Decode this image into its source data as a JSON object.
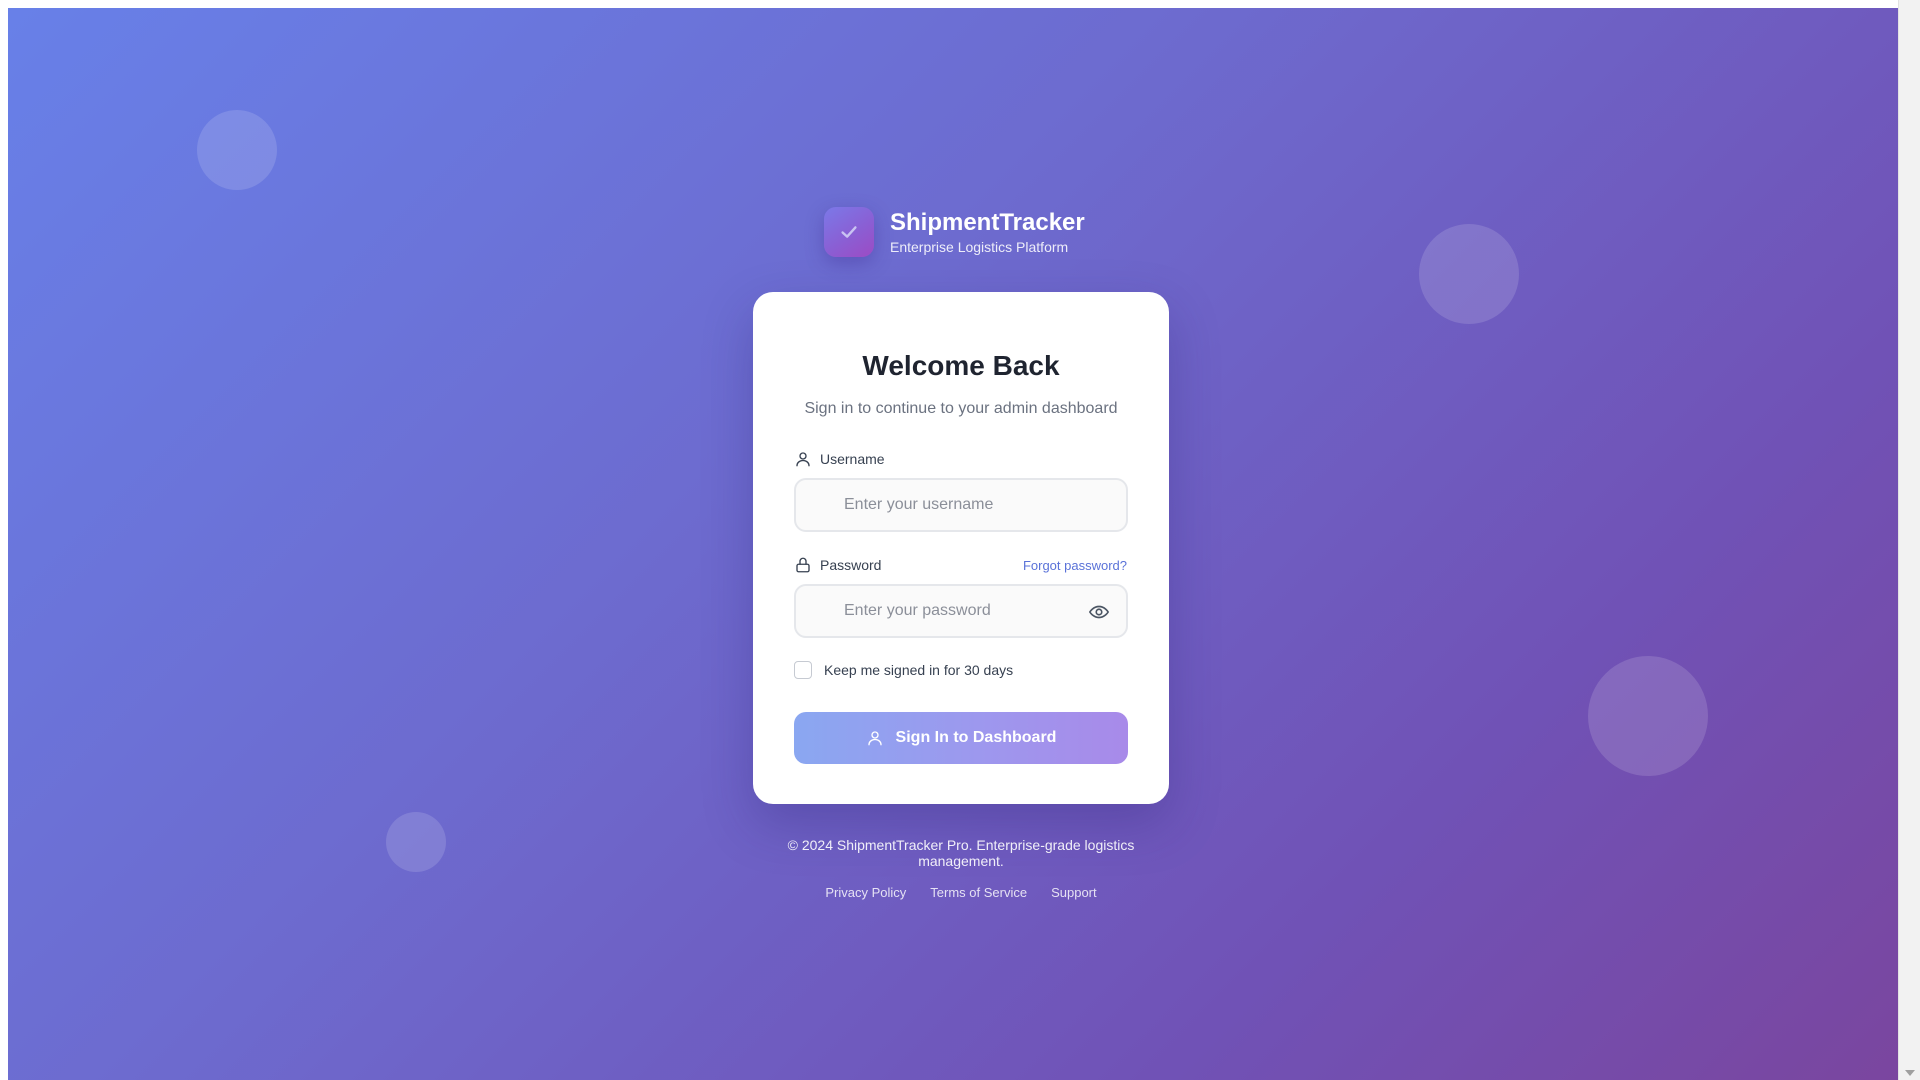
{
  "brand": {
    "name": "ShipmentTracker",
    "tagline": "Enterprise Logistics Platform",
    "logo_icon": "check-icon"
  },
  "card": {
    "title": "Welcome Back",
    "subtitle": "Sign in to continue to your admin dashboard"
  },
  "username": {
    "label": "Username",
    "placeholder": "Enter your username",
    "value": "",
    "icon": "user-icon"
  },
  "password": {
    "label": "Password",
    "placeholder": "Enter your password",
    "value": "",
    "icon": "lock-icon",
    "toggle_icon": "eye-icon",
    "forgot_label": "Forgot password?"
  },
  "remember": {
    "label": "Keep me signed in for 30 days",
    "checked": false
  },
  "signin": {
    "label": "Sign In to Dashboard",
    "icon": "user-icon"
  },
  "footer": {
    "copyright": "© 2024 ShipmentTracker Pro. Enterprise-grade logistics management.",
    "links": [
      "Privacy Policy",
      "Terms of Service",
      "Support"
    ]
  },
  "colors": {
    "background_start": "#6880e8",
    "background_end": "#7a469f",
    "accent": "#5a72d8",
    "button_start": "#8aa7f1",
    "button_end": "#a88ae9"
  }
}
